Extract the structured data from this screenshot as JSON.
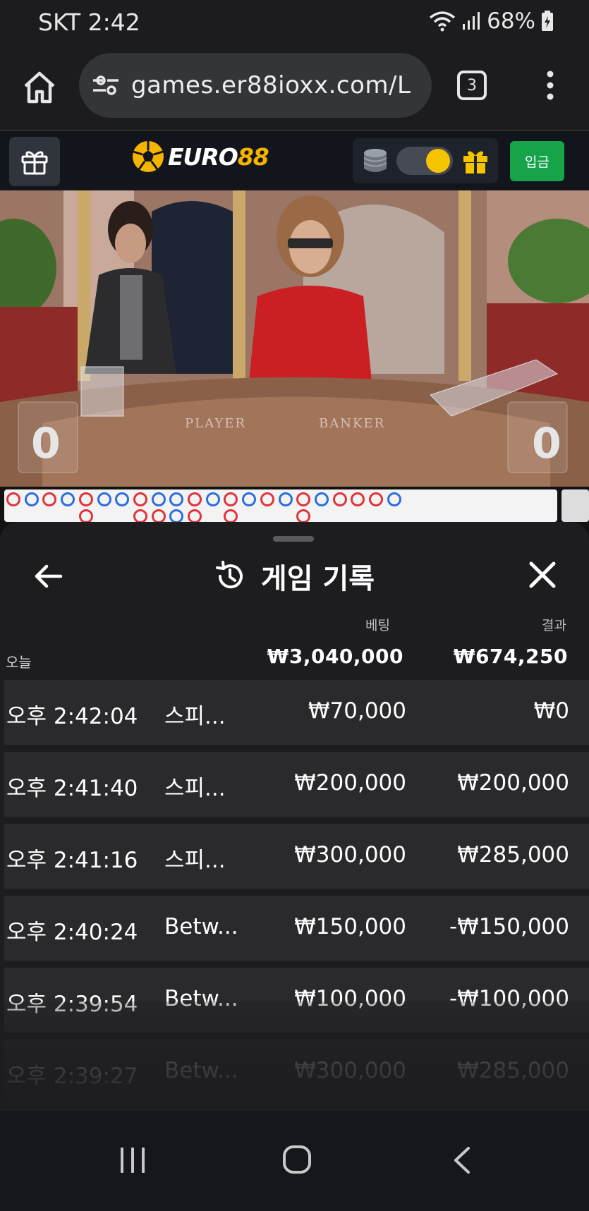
{
  "status_bar": {
    "carrier_time": "SKT 2:42",
    "battery": "68%"
  },
  "browser": {
    "url": "games.er88ioxx.com/L",
    "tab_count": "3"
  },
  "site_header": {
    "logo_word": "EURO",
    "logo_number": "88",
    "deposit_label": "입금",
    "accent_color": "#f5b400",
    "deposit_color": "#16a34a"
  },
  "video": {
    "player_score": "0",
    "banker_score": "0",
    "player_label": "PLAYER",
    "banker_label": "BANKER"
  },
  "sheet": {
    "title": "게임 기록",
    "col_bet": "베팅",
    "col_result": "결과",
    "today_label": "오늘",
    "total_bet": "₩3,040,000",
    "total_result": "₩674,250",
    "rows": [
      {
        "time": "오후 2:42:04",
        "game": "스피...",
        "bet": "₩70,000",
        "result": "₩0"
      },
      {
        "time": "오후 2:41:40",
        "game": "스피...",
        "bet": "₩200,000",
        "result": "₩200,000"
      },
      {
        "time": "오후 2:41:16",
        "game": "스피...",
        "bet": "₩300,000",
        "result": "₩285,000"
      },
      {
        "time": "오후 2:40:24",
        "game": "Betw...",
        "bet": "₩150,000",
        "result": "-₩150,000"
      },
      {
        "time": "오후 2:39:54",
        "game": "Betw...",
        "bet": "₩100,000",
        "result": "-₩100,000"
      },
      {
        "time": "오후 2:39:27",
        "game": "Betw...",
        "bet": "₩300,000",
        "result": "₩285,000"
      }
    ]
  },
  "roadmap": {
    "top_row": [
      "R",
      "B",
      "R",
      "B",
      "R",
      "B",
      "B",
      "R",
      "B",
      "B",
      "R",
      "B",
      "R",
      "B",
      "R",
      "B",
      "R",
      "B",
      "R",
      "R",
      "R",
      "B"
    ],
    "bottom_row": {
      "4": "R",
      "7": "R",
      "8": "R",
      "9": "B",
      "10": "R",
      "12": "R",
      "16": "R"
    }
  },
  "icons": {
    "home": "home-icon",
    "tune": "tune-icon",
    "menu": "more-vert-icon",
    "history": "history-icon",
    "back": "arrow-left-icon",
    "close": "close-icon"
  }
}
